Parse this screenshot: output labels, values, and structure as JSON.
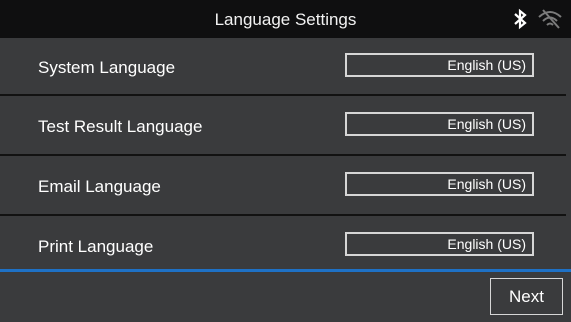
{
  "header": {
    "title": "Language Settings",
    "icons": [
      "bluetooth-icon",
      "wifi-off-icon"
    ]
  },
  "settings": [
    {
      "label": "System Language",
      "value": "English (US)"
    },
    {
      "label": "Test Result Language",
      "value": "English (US)"
    },
    {
      "label": "Email Language",
      "value": "English (US)"
    },
    {
      "label": "Print Language",
      "value": "English (US)"
    }
  ],
  "footer": {
    "next_label": "Next"
  },
  "colors": {
    "header_bg": "#0f0f10",
    "body_bg": "#3a3b3d",
    "accent_line": "#1e71c6",
    "border": "#d6d6d6"
  }
}
